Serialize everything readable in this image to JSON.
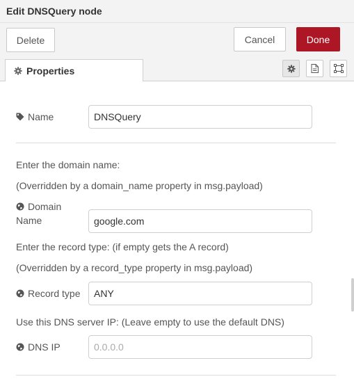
{
  "dialog": {
    "title": "Edit DNSQuery node"
  },
  "toolbar": {
    "delete_label": "Delete",
    "cancel_label": "Cancel",
    "done_label": "Done"
  },
  "tabs": {
    "properties_label": "Properties",
    "icons": [
      "gear-icon",
      "description-icon",
      "appearance-icon"
    ]
  },
  "form": {
    "name": {
      "label": "Name",
      "value": "DNSQuery"
    },
    "domain_intro": "Enter the domain name:",
    "domain_override": "(Overridden by a domain_name property in msg.payload)",
    "domain": {
      "label_line1": "Domain",
      "label_line2": "Name",
      "value": "google.com"
    },
    "record_intro": "Enter the record type: (if empty gets the A record)",
    "record_override": "(Overridden by a record_type property in msg.payload)",
    "record_type": {
      "label": "Record type",
      "value": "ANY"
    },
    "dns_intro": "Use this DNS server IP: (Leave empty to use the default DNS)",
    "dns_ip": {
      "label": "DNS IP",
      "value": "",
      "placeholder": "0.0.0.0"
    }
  },
  "colors": {
    "done_button": "#ad1625",
    "header_bg": "#f3f3f3"
  }
}
